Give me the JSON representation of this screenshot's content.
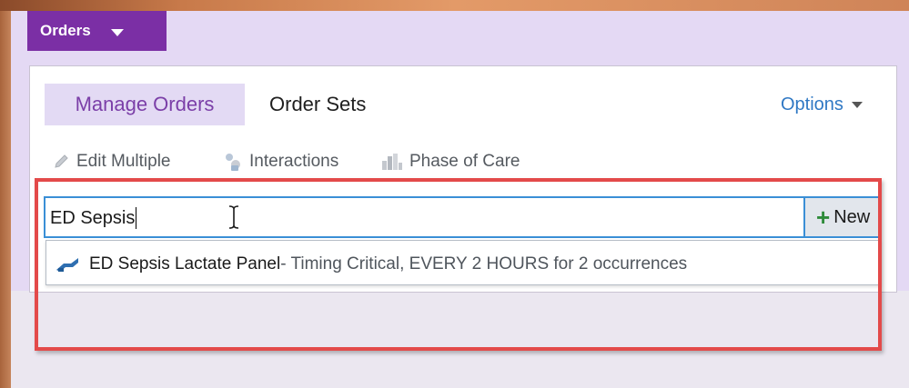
{
  "window": {
    "menu_tab_label": "Orders"
  },
  "tabs": {
    "manage_orders": "Manage Orders",
    "order_sets": "Order Sets"
  },
  "options_label": "Options",
  "toolbar": {
    "edit_multiple": "Edit Multiple",
    "interactions": "Interactions",
    "phase_of_care": "Phase of Care"
  },
  "search": {
    "value": "ED Sepsis"
  },
  "new_button_label": "New",
  "results": [
    {
      "name": "ED Sepsis Lactate Panel",
      "detail": " - Timing Critical, EVERY 2 HOURS  for 2 occurrences",
      "icon": "order-icon"
    }
  ],
  "colors": {
    "accent_purple": "#7b2fa5",
    "link_blue": "#2f78c4",
    "highlight_red": "#e34a4a",
    "search_border": "#3a8fd6"
  }
}
